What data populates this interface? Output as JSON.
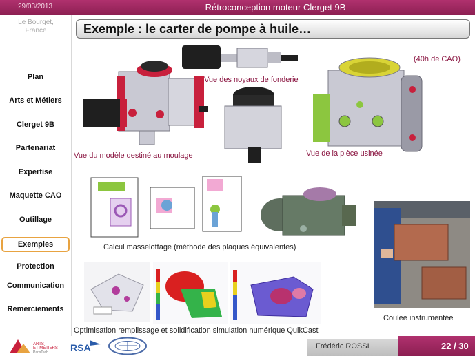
{
  "header": {
    "date": "29/03/2013",
    "title": "Rétroconception moteur Clerget 9B"
  },
  "sidebar": {
    "location_line1": "Le Bourget,",
    "location_line2": "France",
    "items": [
      {
        "label": "Plan"
      },
      {
        "label": "Arts et Métiers"
      },
      {
        "label": "Clerget 9B"
      },
      {
        "label": "Partenariat"
      },
      {
        "label": "Expertise"
      },
      {
        "label": "Maquette CAO"
      },
      {
        "label": "Outillage"
      },
      {
        "label": "Exemples",
        "active": true
      },
      {
        "label": "Protection"
      },
      {
        "label": "Communication"
      },
      {
        "label": "Remerciements"
      }
    ]
  },
  "slide": {
    "heading": "Exemple : le carter de pompe à huile…",
    "captions": {
      "noyaux": "Vue des noyaux de fonderie",
      "cao_time": "(40h de CAO)",
      "moulage": "Vue du modèle destiné au moulage",
      "usinee": "Vue de la pièce usinée",
      "masselottage": "Calcul masselottage (méthode des plaques équivalentes)",
      "simulation": "Optimisation remplissage et solidification simulation numérique QuikCast",
      "coulee": "Coulée instrumentée"
    }
  },
  "footer": {
    "logo_am_line1": "ARTS",
    "logo_am_line2": "ET MÉTIERS",
    "logo_am_line3": "ParisTech",
    "logo_rsa": "RSA",
    "author": "Frédéric ROSSI",
    "page": "22 / 30"
  },
  "colors": {
    "brand": "#9c2660",
    "caption": "#8a1440",
    "active_outline": "#e8a341"
  }
}
